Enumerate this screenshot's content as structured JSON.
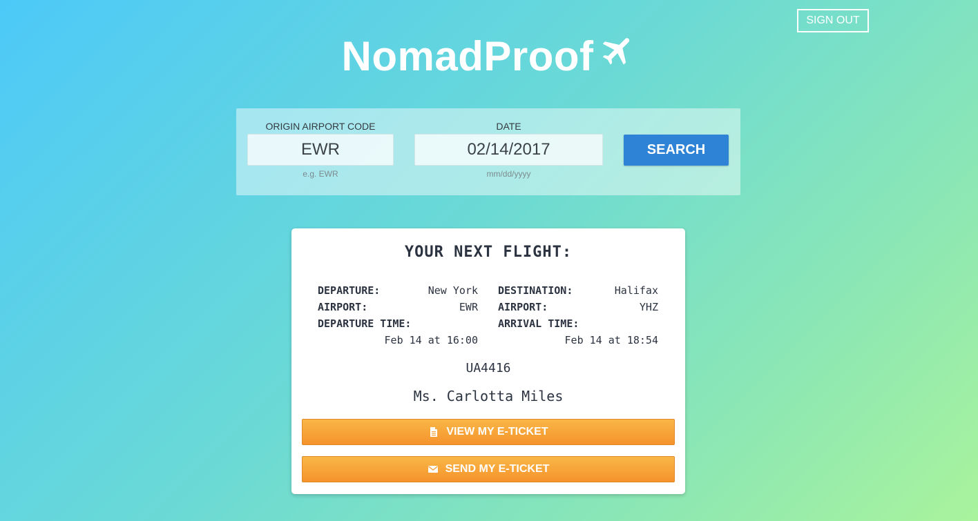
{
  "header": {
    "sign_out_label": "SIGN OUT",
    "brand_title": "NomadProof",
    "brand_icon": "airplane-icon"
  },
  "search": {
    "origin": {
      "label": "ORIGIN AIRPORT CODE",
      "value": "EWR",
      "hint": "e.g. EWR"
    },
    "date": {
      "label": "DATE",
      "value": "02/14/2017",
      "hint": "mm/dd/yyyy"
    },
    "button_label": "SEARCH"
  },
  "flight": {
    "title": "YOUR NEXT FLIGHT:",
    "departure_label": "DEPARTURE:",
    "departure_value": "New York",
    "departure_airport_label": "AIRPORT:",
    "departure_airport_value": "EWR",
    "departure_time_label": "DEPARTURE TIME:",
    "departure_time_value": "Feb 14 at 16:00",
    "destination_label": "DESTINATION:",
    "destination_value": "Halifax",
    "arrival_airport_label": "AIRPORT:",
    "arrival_airport_value": "YHZ",
    "arrival_time_label": "ARRIVAL TIME:",
    "arrival_time_value": "Feb 14 at 18:54",
    "flight_number": "UA4416",
    "passenger": "Ms. Carlotta Miles",
    "view_ticket_label": "VIEW MY E-TICKET",
    "send_ticket_label": "SEND MY E-TICKET"
  },
  "colors": {
    "search_button": "#2f83d6",
    "ticket_button": "#f5922c",
    "text_dark": "#2c3340"
  }
}
